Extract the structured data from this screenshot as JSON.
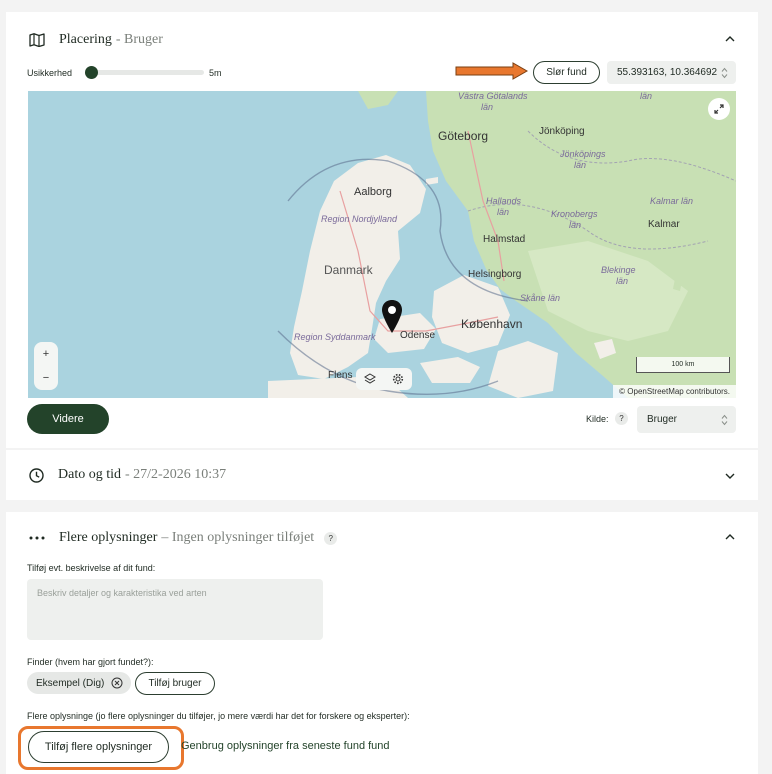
{
  "placering": {
    "title": "Placering",
    "subtitle": "- Bruger",
    "uncertainty_label": "Usikkerhed",
    "uncertainty_value": "5m",
    "blur_button": "Slør fund",
    "coordinates": "55.393163, 10.364692",
    "map": {
      "zoom_in": "+",
      "zoom_out": "−",
      "scale_label": "100 km",
      "attribution": "© OpenStreetMap contributors.",
      "labels": {
        "vastra_gotaland": "Västra Götalands",
        "lan1": "län",
        "goteborg": "Göteborg",
        "jonkoping": "Jönköping",
        "jonkopings": "Jönköpings",
        "lan2": "län",
        "aalborg": "Aalborg",
        "region_nord": "Region Nordjylland",
        "hallands": "Hallands",
        "lan3": "län",
        "kronobergs": "Kronobergs",
        "lan4": "län",
        "kalmar_lan": "Kalmar län",
        "kalmar": "Kalmar",
        "halmstad": "Halmstad",
        "danmark": "Danmark",
        "helsingborg": "Helsingborg",
        "blekinge": "Blekinge",
        "lan5": "län",
        "skane": "Skåne län",
        "kobenhavn": "København",
        "odense": "Odense",
        "region_syd": "Region Syddanmark",
        "flens": "Flens",
        "lan_top_right": "län"
      }
    },
    "continue_button": "Videre",
    "source_label": "Kilde:",
    "source_help": "?",
    "source_value": "Bruger"
  },
  "dato": {
    "title": "Dato og tid",
    "value": "- 27/2-2026 10:37"
  },
  "flere": {
    "title": "Flere oplysninger",
    "subtitle": "– Ingen oplysninger tilføjet",
    "help": "?",
    "desc_label": "Tilføj evt. beskrivelse af dit fund:",
    "desc_placeholder": "Beskriv detaljer og karakteristika ved arten",
    "finder_label": "Finder (hvem har gjort fundet?):",
    "finder_chip": "Eksempel (Dig)",
    "add_user_button": "Tilføj bruger",
    "more_label": "Flere oplysninge (jo flere oplysninger du tilføjer, jo mere værdi har det for forskere og eksperter):",
    "add_more_button": "Tilføj flere oplysninger",
    "reuse_link": "Genbrug oplysninger fra seneste fund fund"
  },
  "colors": {
    "primary": "#23432a",
    "annotation_orange": "#e8772e",
    "map_water": "#aad3df",
    "map_land": "#f2efe9",
    "map_green": "#c8e0b4"
  }
}
